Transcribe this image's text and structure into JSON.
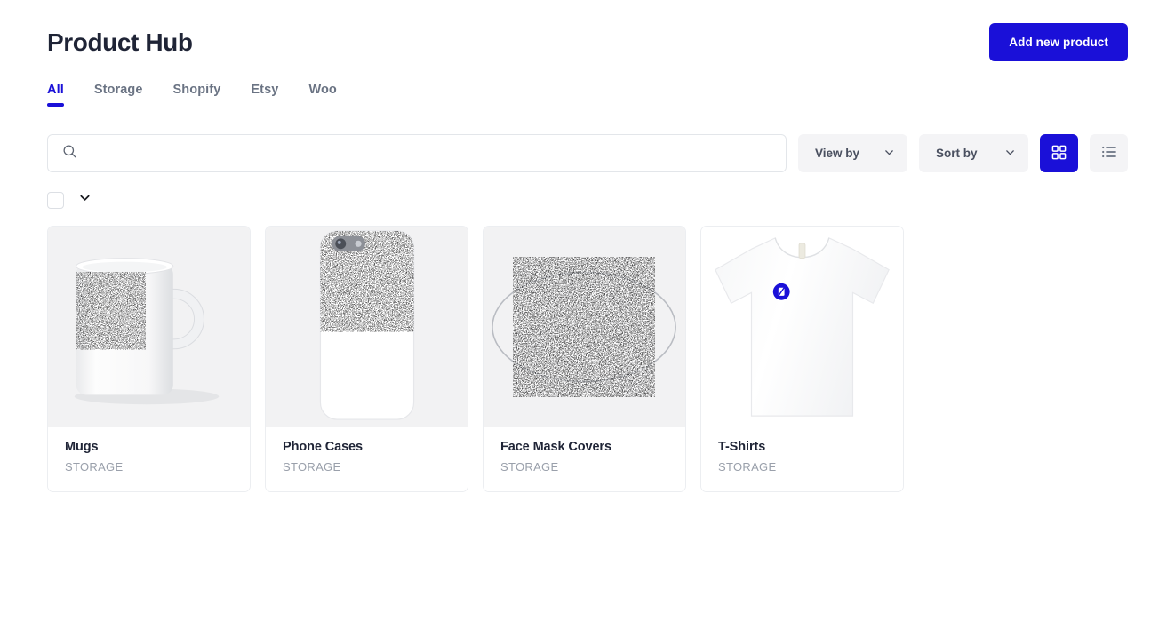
{
  "header": {
    "title": "Product Hub",
    "add_button_label": "Add new product",
    "accent_color": "#1a10d8"
  },
  "tabs": [
    {
      "label": "All",
      "active": true
    },
    {
      "label": "Storage",
      "active": false
    },
    {
      "label": "Shopify",
      "active": false
    },
    {
      "label": "Etsy",
      "active": false
    },
    {
      "label": "Woo",
      "active": false
    }
  ],
  "toolbar": {
    "search": {
      "value": "",
      "placeholder": "",
      "icon": "search-icon"
    },
    "view_by": {
      "label": "View by",
      "icon": "chevron-down-icon"
    },
    "sort_by": {
      "label": "Sort by",
      "icon": "chevron-down-icon"
    },
    "grid_view": {
      "icon": "grid-view-icon",
      "active": true
    },
    "list_view": {
      "icon": "list-view-icon",
      "active": false
    }
  },
  "select_row": {
    "checkbox_checked": false,
    "caret_icon": "chevron-down-icon"
  },
  "products": [
    {
      "title": "Mugs",
      "source": "STORAGE",
      "image": "mug-image"
    },
    {
      "title": "Phone Cases",
      "source": "STORAGE",
      "image": "phone-case-image"
    },
    {
      "title": "Face Mask Covers",
      "source": "STORAGE",
      "image": "face-mask-image"
    },
    {
      "title": "T-Shirts",
      "source": "STORAGE",
      "image": "t-shirt-image"
    }
  ]
}
